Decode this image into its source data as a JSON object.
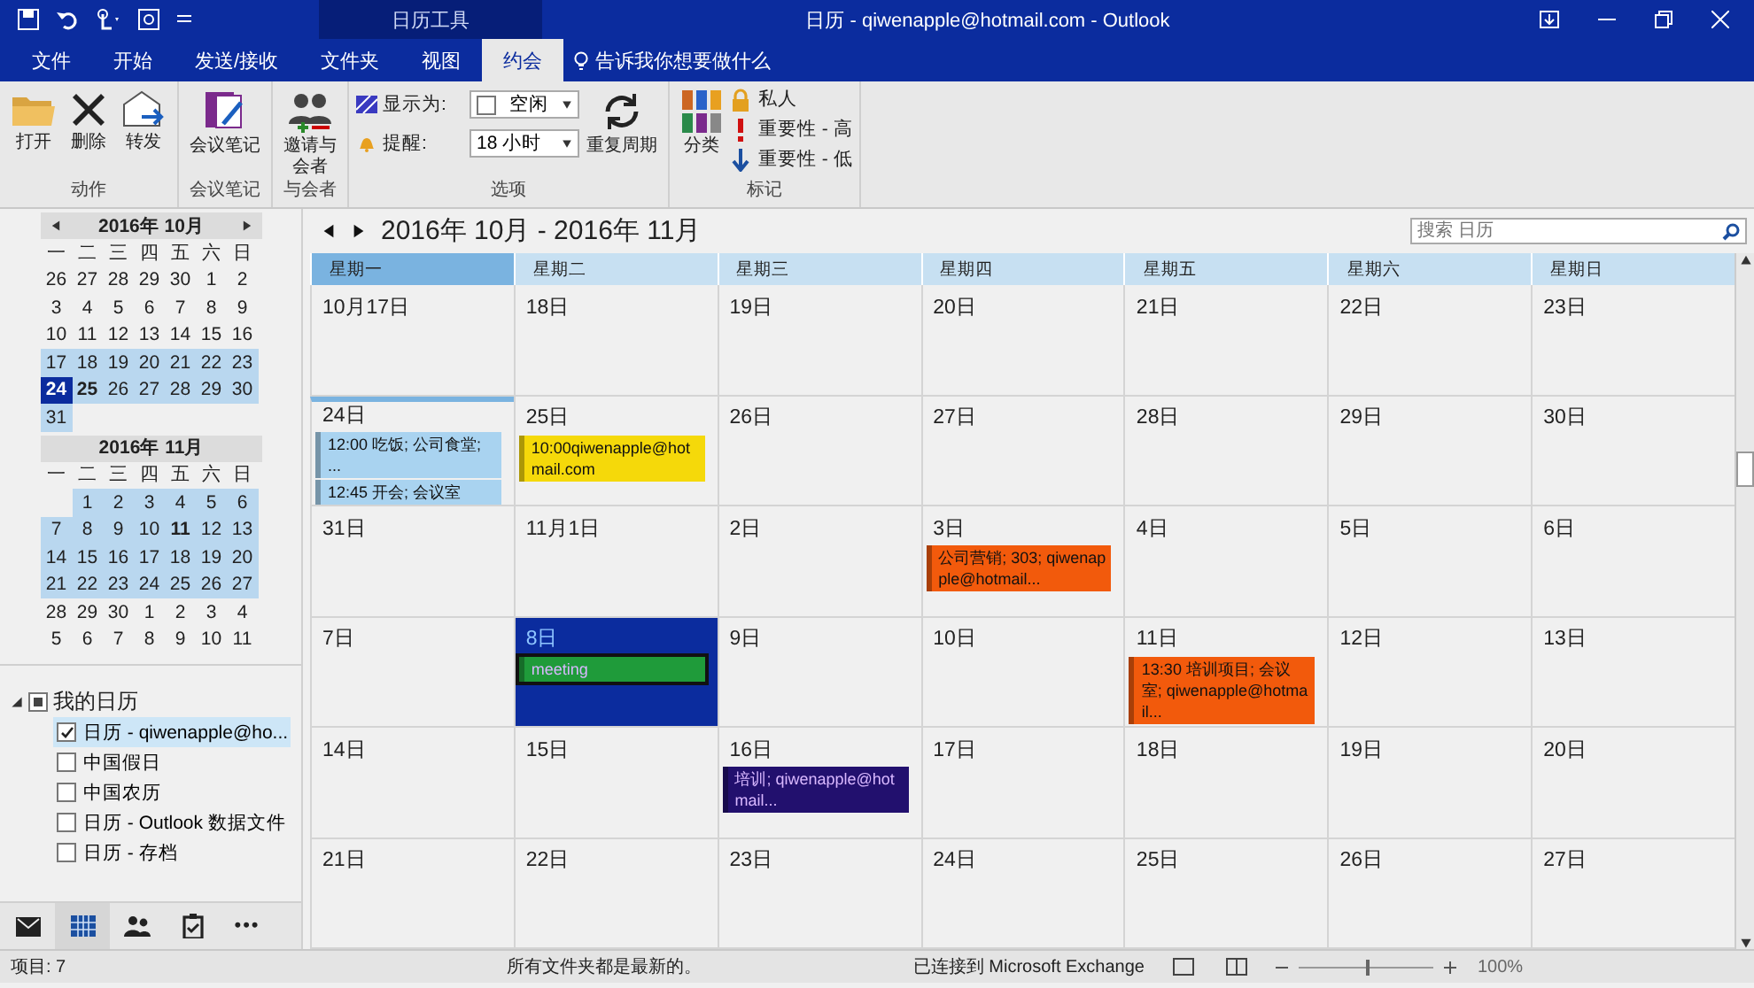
{
  "window": {
    "context_tab": "日历工具",
    "title": "日历 - qiwenapple@hotmail.com - Outlook"
  },
  "tabs": [
    {
      "label": "文件",
      "selected": false
    },
    {
      "label": "开始",
      "selected": false
    },
    {
      "label": "发送/接收",
      "selected": false
    },
    {
      "label": "文件夹",
      "selected": false
    },
    {
      "label": "视图",
      "selected": false
    },
    {
      "label": "约会",
      "selected": true
    }
  ],
  "tell_me": "告诉我你想要做什么",
  "ribbon": [
    {
      "label": "动作",
      "items": [
        {
          "kind": "open",
          "label": "打开"
        },
        {
          "kind": "delete",
          "label": "删除"
        },
        {
          "kind": "forward",
          "label": "转发"
        }
      ]
    },
    {
      "label": "会议笔记",
      "items": [
        {
          "kind": "note",
          "label": "会议笔记"
        }
      ]
    },
    {
      "label": "与会者",
      "items": [
        {
          "kind": "invite",
          "label": "邀请与会者"
        }
      ]
    },
    {
      "label": "选项",
      "show_as": {
        "label": "显示为:",
        "value": "空闲"
      },
      "reminder": {
        "label": "提醒:",
        "value": "18 小时"
      },
      "items": [
        {
          "kind": "recur",
          "label": "重复周期"
        }
      ]
    },
    {
      "label": "标记",
      "items": [
        {
          "kind": "category",
          "label": "分类"
        }
      ],
      "flags": [
        {
          "kind": "private",
          "label": "私人"
        },
        {
          "kind": "high",
          "label": "重要性 - 高"
        },
        {
          "kind": "low",
          "label": "重要性 - 低"
        }
      ]
    }
  ],
  "mini_calendars": [
    {
      "title": "2016年 10月",
      "nav": true,
      "weekdays": [
        "一",
        "二",
        "三",
        "四",
        "五",
        "六",
        "日"
      ],
      "weeks": [
        {
          "highlighted": false,
          "days": [
            {
              "d": "26",
              "bold": false,
              "selected": false
            },
            {
              "d": "27",
              "bold": false,
              "selected": false
            },
            {
              "d": "28",
              "bold": false,
              "selected": false
            },
            {
              "d": "29",
              "bold": false,
              "selected": false
            },
            {
              "d": "30",
              "bold": false,
              "selected": false
            },
            {
              "d": "1",
              "bold": false,
              "selected": false
            },
            {
              "d": "2",
              "bold": false,
              "selected": false
            }
          ]
        },
        {
          "highlighted": false,
          "days": [
            {
              "d": "3",
              "bold": false,
              "selected": false
            },
            {
              "d": "4",
              "bold": false,
              "selected": false
            },
            {
              "d": "5",
              "bold": false,
              "selected": false
            },
            {
              "d": "6",
              "bold": false,
              "selected": false
            },
            {
              "d": "7",
              "bold": false,
              "selected": false
            },
            {
              "d": "8",
              "bold": false,
              "selected": false
            },
            {
              "d": "9",
              "bold": false,
              "selected": false
            }
          ]
        },
        {
          "highlighted": false,
          "days": [
            {
              "d": "10",
              "bold": false,
              "selected": false
            },
            {
              "d": "11",
              "bold": false,
              "selected": false
            },
            {
              "d": "12",
              "bold": false,
              "selected": false
            },
            {
              "d": "13",
              "bold": false,
              "selected": false
            },
            {
              "d": "14",
              "bold": false,
              "selected": false
            },
            {
              "d": "15",
              "bold": false,
              "selected": false
            },
            {
              "d": "16",
              "bold": false,
              "selected": false
            }
          ]
        },
        {
          "highlighted": true,
          "days": [
            {
              "d": "17",
              "bold": false,
              "selected": false
            },
            {
              "d": "18",
              "bold": false,
              "selected": false
            },
            {
              "d": "19",
              "bold": false,
              "selected": false
            },
            {
              "d": "20",
              "bold": false,
              "selected": false
            },
            {
              "d": "21",
              "bold": false,
              "selected": false
            },
            {
              "d": "22",
              "bold": false,
              "selected": false
            },
            {
              "d": "23",
              "bold": false,
              "selected": false
            }
          ]
        },
        {
          "highlighted": true,
          "days": [
            {
              "d": "24",
              "bold": true,
              "selected": true
            },
            {
              "d": "25",
              "bold": true,
              "selected": false
            },
            {
              "d": "26",
              "bold": false,
              "selected": false
            },
            {
              "d": "27",
              "bold": false,
              "selected": false
            },
            {
              "d": "28",
              "bold": false,
              "selected": false
            },
            {
              "d": "29",
              "bold": false,
              "selected": false
            },
            {
              "d": "30",
              "bold": false,
              "selected": false
            }
          ]
        },
        {
          "highlighted": true,
          "days": [
            {
              "d": "31",
              "bold": false,
              "selected": false
            }
          ]
        }
      ]
    },
    {
      "title": "2016年 11月",
      "nav": false,
      "weekdays": [
        "一",
        "二",
        "三",
        "四",
        "五",
        "六",
        "日"
      ],
      "weeks": [
        {
          "highlighted": true,
          "days": [
            {
              "kind": "blank"
            },
            {
              "d": "1",
              "bold": false,
              "selected": false
            },
            {
              "d": "2",
              "bold": false,
              "selected": false
            },
            {
              "d": "3",
              "bold": false,
              "selected": false
            },
            {
              "d": "4",
              "bold": false,
              "selected": false
            },
            {
              "d": "5",
              "bold": false,
              "selected": false
            },
            {
              "d": "6",
              "bold": false,
              "selected": false
            }
          ]
        },
        {
          "highlighted": true,
          "days": [
            {
              "d": "7",
              "bold": false,
              "selected": false
            },
            {
              "d": "8",
              "bold": false,
              "selected": false
            },
            {
              "d": "9",
              "bold": false,
              "selected": false
            },
            {
              "d": "10",
              "bold": false,
              "selected": false
            },
            {
              "d": "11",
              "bold": true,
              "selected": false
            },
            {
              "d": "12",
              "bold": false,
              "selected": false
            },
            {
              "d": "13",
              "bold": false,
              "selected": false
            }
          ]
        },
        {
          "highlighted": true,
          "days": [
            {
              "d": "14",
              "bold": false,
              "selected": false
            },
            {
              "d": "15",
              "bold": false,
              "selected": false
            },
            {
              "d": "16",
              "bold": false,
              "selected": false
            },
            {
              "d": "17",
              "bold": false,
              "selected": false
            },
            {
              "d": "18",
              "bold": false,
              "selected": false
            },
            {
              "d": "19",
              "bold": false,
              "selected": false
            },
            {
              "d": "20",
              "bold": false,
              "selected": false
            }
          ]
        },
        {
          "highlighted": true,
          "days": [
            {
              "d": "21",
              "bold": false,
              "selected": false
            },
            {
              "d": "22",
              "bold": false,
              "selected": false
            },
            {
              "d": "23",
              "bold": false,
              "selected": false
            },
            {
              "d": "24",
              "bold": false,
              "selected": false
            },
            {
              "d": "25",
              "bold": false,
              "selected": false
            },
            {
              "d": "26",
              "bold": false,
              "selected": false
            },
            {
              "d": "27",
              "bold": false,
              "selected": false
            }
          ]
        },
        {
          "highlighted": false,
          "days": [
            {
              "d": "28",
              "bold": false,
              "selected": false
            },
            {
              "d": "29",
              "bold": false,
              "selected": false
            },
            {
              "d": "30",
              "bold": false,
              "selected": false
            },
            {
              "d": "1",
              "bold": false,
              "selected": false
            },
            {
              "d": "2",
              "bold": false,
              "selected": false
            },
            {
              "d": "3",
              "bold": false,
              "selected": false
            },
            {
              "d": "4",
              "bold": false,
              "selected": false
            }
          ]
        },
        {
          "highlighted": false,
          "days": [
            {
              "d": "5",
              "bold": false,
              "selected": false
            },
            {
              "d": "6",
              "bold": false,
              "selected": false
            },
            {
              "d": "7",
              "bold": false,
              "selected": false
            },
            {
              "d": "8",
              "bold": false,
              "selected": false
            },
            {
              "d": "9",
              "bold": false,
              "selected": false
            },
            {
              "d": "10",
              "bold": false,
              "selected": false
            },
            {
              "d": "11",
              "bold": false,
              "selected": false
            }
          ]
        }
      ]
    }
  ],
  "folders": [
    {
      "label": "我的日历",
      "expanded": true,
      "partially_checked": true,
      "children": [
        {
          "label": "日历 - qiwenapple@ho...",
          "checked": true,
          "selected": true
        },
        {
          "label": "中国假日",
          "checked": false,
          "selected": false
        },
        {
          "label": "中国农历",
          "checked": false,
          "selected": false
        },
        {
          "label": "日历 - Outlook 数据文件",
          "checked": false,
          "selected": false
        },
        {
          "label": "日历 - 存档",
          "checked": false,
          "selected": false
        }
      ]
    }
  ],
  "nav_bar": [
    {
      "kind": "mail",
      "selected": false
    },
    {
      "kind": "calendar",
      "selected": true
    },
    {
      "kind": "people",
      "selected": false
    },
    {
      "kind": "tasks",
      "selected": false
    },
    {
      "kind": "more",
      "label": "•••",
      "selected": false
    }
  ],
  "calendar": {
    "title": "2016年 10月 - 2016年 11月",
    "search": {
      "placeholder": "搜索 日历"
    },
    "weekdays": [
      {
        "label": "星期一",
        "selected": true
      },
      {
        "label": "星期二",
        "selected": false
      },
      {
        "label": "星期三",
        "selected": false
      },
      {
        "label": "星期四",
        "selected": false
      },
      {
        "label": "星期五",
        "selected": false
      },
      {
        "label": "星期六",
        "selected": false
      },
      {
        "label": "星期日",
        "selected": false
      }
    ],
    "weeks": [
      [
        {
          "label": "10月17日",
          "today": false,
          "selected": false
        },
        {
          "label": "18日",
          "today": false,
          "selected": false
        },
        {
          "label": "19日",
          "today": false,
          "selected": false
        },
        {
          "label": "20日",
          "today": false,
          "selected": false
        },
        {
          "label": "21日",
          "today": false,
          "selected": false
        },
        {
          "label": "22日",
          "today": false,
          "selected": false
        },
        {
          "label": "23日",
          "today": false,
          "selected": false
        }
      ],
      [
        {
          "label": "24日",
          "today": true,
          "selected": false,
          "events": [
            {
              "text": "12:00 吃饭; 公司食堂; ...",
              "color": "#a9d3f0",
              "selected": false
            },
            {
              "text": "12:45 开会; 会议室",
              "color": "#a9d3f0",
              "selected": false
            }
          ]
        },
        {
          "label": "25日",
          "today": false,
          "selected": false,
          "events": [
            {
              "text": "10:00qiwenapple@hotmail.com",
              "color": "#f5d90a",
              "selected": false
            }
          ]
        },
        {
          "label": "26日",
          "today": false,
          "selected": false
        },
        {
          "label": "27日",
          "today": false,
          "selected": false
        },
        {
          "label": "28日",
          "today": false,
          "selected": false
        },
        {
          "label": "29日",
          "today": false,
          "selected": false
        },
        {
          "label": "30日",
          "today": false,
          "selected": false
        }
      ],
      [
        {
          "label": "31日",
          "today": false,
          "selected": false
        },
        {
          "label": "11月1日",
          "today": false,
          "selected": false
        },
        {
          "label": "2日",
          "today": false,
          "selected": false
        },
        {
          "label": "3日",
          "today": false,
          "selected": false,
          "events": [
            {
              "text": "公司营销; 303; qiwenapple@hotmail...",
              "color": "#f25a0c",
              "selected": false
            }
          ]
        },
        {
          "label": "4日",
          "today": false,
          "selected": false
        },
        {
          "label": "5日",
          "today": false,
          "selected": false
        },
        {
          "label": "6日",
          "today": false,
          "selected": false
        }
      ],
      [
        {
          "label": "7日",
          "today": false,
          "selected": false
        },
        {
          "label": "8日",
          "today": false,
          "selected": true,
          "events": [
            {
              "text": "meeting",
              "color": "#1f9b3a",
              "selected": true
            }
          ]
        },
        {
          "label": "9日",
          "today": false,
          "selected": false
        },
        {
          "label": "10日",
          "today": false,
          "selected": false
        },
        {
          "label": "11日",
          "today": false,
          "selected": false,
          "events": [
            {
              "text": "13:30 培训项目; 会议室; qiwenapple@hotmail...",
              "color": "#f25a0c",
              "selected": false
            }
          ]
        },
        {
          "label": "12日",
          "today": false,
          "selected": false
        },
        {
          "label": "13日",
          "today": false,
          "selected": false
        }
      ],
      [
        {
          "label": "14日",
          "today": false,
          "selected": false
        },
        {
          "label": "15日",
          "today": false,
          "selected": false
        },
        {
          "label": "16日",
          "today": false,
          "selected": false,
          "events": [
            {
              "text": "培训; qiwenapple@hotmail...",
              "color": "#22106e",
              "selected": false
            }
          ]
        },
        {
          "label": "17日",
          "today": false,
          "selected": false
        },
        {
          "label": "18日",
          "today": false,
          "selected": false
        },
        {
          "label": "19日",
          "today": false,
          "selected": false
        },
        {
          "label": "20日",
          "today": false,
          "selected": false
        }
      ],
      [
        {
          "label": "21日",
          "today": false,
          "selected": false
        },
        {
          "label": "22日",
          "today": false,
          "selected": false
        },
        {
          "label": "23日",
          "today": false,
          "selected": false
        },
        {
          "label": "24日",
          "today": false,
          "selected": false
        },
        {
          "label": "25日",
          "today": false,
          "selected": false
        },
        {
          "label": "26日",
          "today": false,
          "selected": false
        },
        {
          "label": "27日",
          "today": false,
          "selected": false
        }
      ]
    ]
  },
  "status_bar": {
    "items": "项目: 7",
    "sync": "所有文件夹都是最新的。",
    "connection": "已连接到 Microsoft Exchange",
    "zoom": {
      "level": 0.5,
      "reading": "100%"
    }
  }
}
